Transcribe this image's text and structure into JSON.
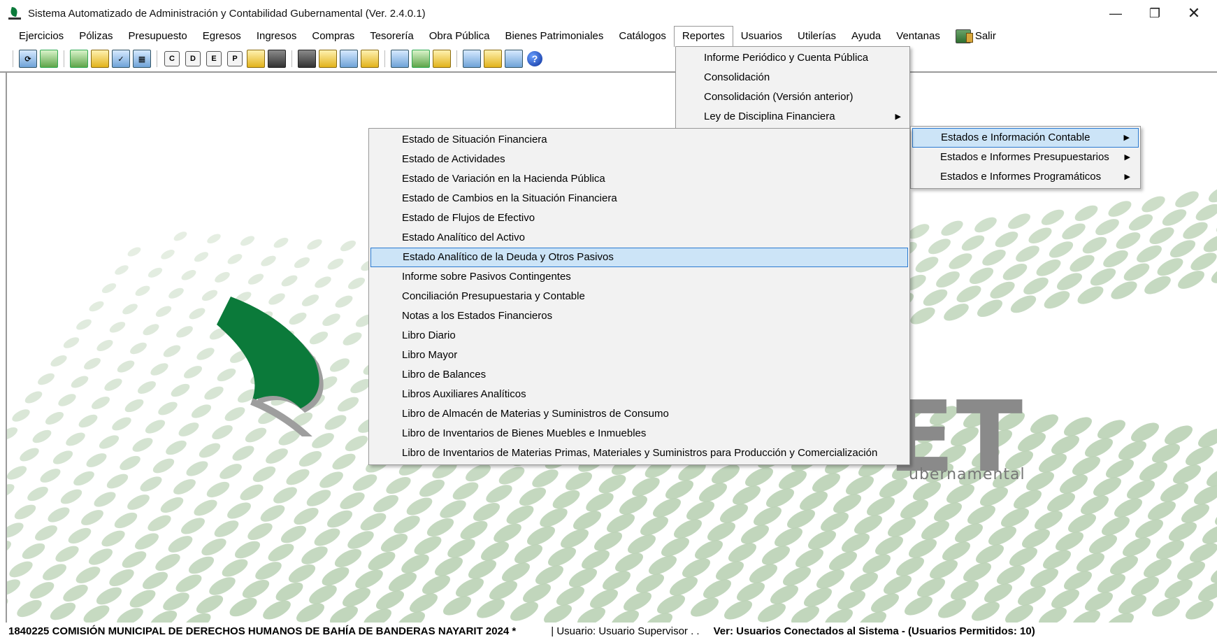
{
  "window": {
    "title": "Sistema Automatizado de Administración y Contabilidad Gubernamental  (Ver. 2.4.0.1)",
    "controls": {
      "minimize": "—",
      "maximize": "❐",
      "close": "✕"
    }
  },
  "menubar": {
    "items": [
      "Ejercicios",
      "Pólizas",
      "Presupuesto",
      "Egresos",
      "Ingresos",
      "Compras",
      "Tesorería",
      "Obra Pública",
      "Bienes Patrimoniales",
      "Catálogos",
      "Reportes",
      "Usuarios",
      "Utilerías",
      "Ayuda",
      "Ventanas"
    ],
    "open_item": "Reportes",
    "salir_label": "Salir"
  },
  "toolbar": {
    "letters": [
      "C",
      "D",
      "E",
      "P"
    ],
    "help_glyph": "?"
  },
  "logo": {
    "big_text": "ET",
    "sub_text": "ubernamental"
  },
  "reportes_menu": {
    "items": [
      {
        "label": "Informe Periódico y Cuenta Pública",
        "submenu": false
      },
      {
        "label": "Consolidación",
        "submenu": false
      },
      {
        "label": "Consolidación (Versión anterior)",
        "submenu": false
      },
      {
        "label": "Ley de Disciplina Financiera",
        "submenu": true
      }
    ]
  },
  "estados_menu": {
    "items": [
      {
        "label": "Estados e Información Contable",
        "submenu": true,
        "highlighted": true
      },
      {
        "label": "Estados e Informes Presupuestarios",
        "submenu": true,
        "highlighted": false
      },
      {
        "label": "Estados e Informes Programáticos",
        "submenu": true,
        "highlighted": false
      }
    ]
  },
  "contable_menu": {
    "items": [
      "Estado de Situación Financiera",
      "Estado de Actividades",
      "Estado de Variación en la Hacienda Pública",
      "Estado de Cambios en la Situación Financiera",
      "Estado de Flujos de Efectivo",
      "Estado Analítico del Activo",
      "Estado Analítico de la Deuda y Otros Pasivos",
      "Informe sobre Pasivos Contingentes",
      "Conciliación Presupuestaria y Contable",
      "Notas a los Estados Financieros",
      "Libro Diario",
      "Libro Mayor",
      "Libro de Balances",
      "Libros Auxiliares Analíticos",
      "Libro de Almacén de Materias y Suministros de Consumo",
      "Libro de Inventarios de Bienes Muebles e Inmuebles",
      "Libro de Inventarios de Materias Primas, Materiales y Suministros para Producción y Comercialización"
    ],
    "highlighted_index": 6
  },
  "statusbar": {
    "company": "1840225 COMISIÓN MUNICIPAL DE DERECHOS HUMANOS DE BAHÍA DE BANDERAS NAYARIT  2024   *",
    "user": "| Usuario: Usuario Supervisor . .",
    "connected": "Ver: Usuarios Conectados al Sistema - (Usuarios Permitidos: 10)"
  },
  "colors": {
    "highlight_bg": "#cce4f7",
    "highlight_border": "#2a7ad0",
    "brand_green": "#0b7a3a",
    "menu_bg": "#f2f2f2"
  }
}
